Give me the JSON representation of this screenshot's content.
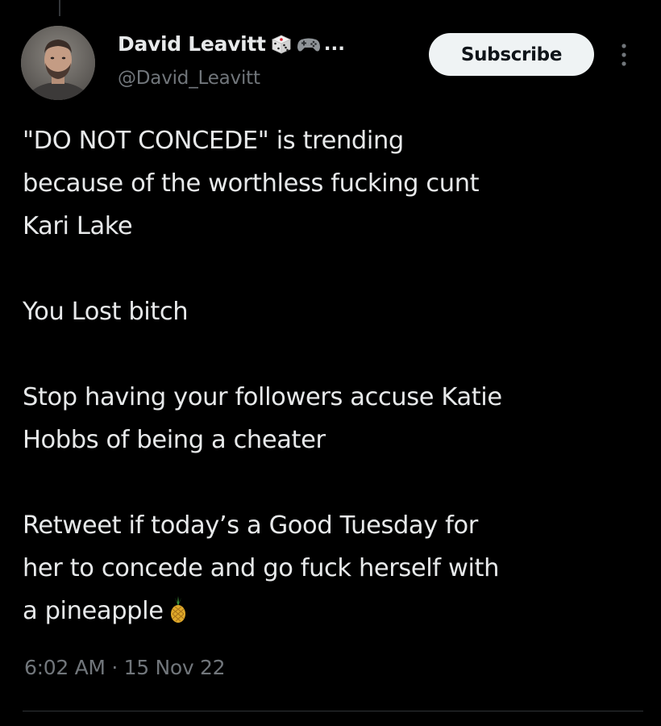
{
  "author": {
    "display_name": "David Leavitt",
    "name_emoji": [
      "game-die-icon",
      "video-game-icon"
    ],
    "name_truncation": "...",
    "handle": "@David_Leavitt"
  },
  "actions": {
    "subscribe_label": "Subscribe",
    "more_icon": "more-vertical-icon"
  },
  "tweet": {
    "paragraphs": [
      {
        "lines": [
          "\"DO NOT CONCEDE\" is trending",
          "because of the worthless fucking cunt",
          "Kari Lake"
        ]
      },
      {
        "lines": [
          "You Lost bitch"
        ]
      },
      {
        "lines": [
          "Stop having your followers accuse Katie",
          "Hobbs of being a cheater"
        ]
      },
      {
        "lines": [
          "Retweet if today’s a Good Tuesday for",
          "her to concede and go fuck herself with",
          "a pineapple"
        ]
      }
    ],
    "trailing_emoji": "pineapple-icon",
    "time": "6:02 AM",
    "separator": "·",
    "date": "15 Nov 22"
  },
  "colors": {
    "background": "#000000",
    "text_primary": "#e7e9ea",
    "text_secondary": "#71767b",
    "button_bg": "#eff3f4",
    "button_text": "#0f1419"
  }
}
